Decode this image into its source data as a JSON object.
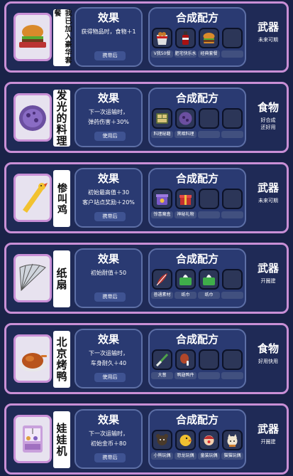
{
  "colors": {
    "card_border": "#c98fd6",
    "card_bg": "#1f2a56",
    "panel_bg": "#2a3a72",
    "panel_border": "#5d6fa6",
    "tag_bg": "#3f5392"
  },
  "items": [
    {
      "name": "我已加入豪华套餐",
      "icon": "burger-icon",
      "effect_title": "效果",
      "effect_desc": "获得物品时，食物＋1",
      "tag": "携带后",
      "recipe_title": "合成配方",
      "ingredients": [
        {
          "icon": "fried-chicken-bucket-icon",
          "label": "V我50餐"
        },
        {
          "icon": "cola-bottle-icon",
          "label": "肥宅快乐水"
        },
        {
          "icon": "burger-icon",
          "label": "经典套餐"
        },
        {
          "icon": "",
          "label": ""
        }
      ],
      "category": "武器",
      "category_note": "未来可期"
    },
    {
      "name": "发光的料理",
      "icon": "glowing-dish-icon",
      "effect_title": "效果",
      "effect_desc": "下一次运输时，\n弹药伤害＋30%",
      "tag": "使用后",
      "recipe_title": "合成配方",
      "ingredients": [
        {
          "icon": "recipe-book-icon",
          "label": "料理秘籍"
        },
        {
          "icon": "dark-dish-icon",
          "label": "黑暗料理"
        },
        {
          "icon": "",
          "label": ""
        },
        {
          "icon": "",
          "label": ""
        }
      ],
      "category": "食物",
      "category_note": "好合成\n还好用"
    },
    {
      "name": "惨叫鸡",
      "icon": "screaming-chicken-icon",
      "effect_title": "效果",
      "effect_desc": "初始最高值＋30\n客户站点奖励＋20%",
      "tag": "携带后",
      "recipe_title": "合成配方",
      "ingredients": [
        {
          "icon": "mystery-box-icon",
          "label": "惊喜魔盒"
        },
        {
          "icon": "gift-box-icon",
          "label": "神秘礼物"
        },
        {
          "icon": "",
          "label": ""
        },
        {
          "icon": "",
          "label": ""
        }
      ],
      "category": "武器",
      "category_note": "未来可期"
    },
    {
      "name": "纸扇",
      "icon": "paper-fan-icon",
      "effect_title": "效果",
      "effect_desc": "初始耐值＋50",
      "tag": "携带后",
      "recipe_title": "合成配方",
      "ingredients": [
        {
          "icon": "feather-icon",
          "label": "普通素材"
        },
        {
          "icon": "tissue-box-icon",
          "label": "纸巾"
        },
        {
          "icon": "tissue-box-icon",
          "label": "纸巾"
        },
        {
          "icon": "",
          "label": ""
        }
      ],
      "category": "武器",
      "category_note": "开圈建"
    },
    {
      "name": "北京烤鸭",
      "icon": "roast-duck-icon",
      "effect_title": "效果",
      "effect_desc": "下一次运输时，\n车身耐久＋40",
      "tag": "使用后",
      "recipe_title": "合成配方",
      "ingredients": [
        {
          "icon": "scallion-icon",
          "label": "大葱"
        },
        {
          "icon": "duck-leg-icon",
          "label": "鸭翅鸭件"
        },
        {
          "icon": "",
          "label": ""
        },
        {
          "icon": "",
          "label": ""
        }
      ],
      "category": "食物",
      "category_note": "好用快用"
    },
    {
      "name": "娃娃机",
      "icon": "claw-machine-icon",
      "effect_title": "效果",
      "effect_desc": "下一次运输时，\n初始金币＋80",
      "tag": "携带后",
      "recipe_title": "合成配方",
      "ingredients": [
        {
          "icon": "bear-doll-icon",
          "label": "小熊玩偶"
        },
        {
          "icon": "chick-doll-icon",
          "label": "恐龙玩偶"
        },
        {
          "icon": "clown-doll-icon",
          "label": "童装玩偶"
        },
        {
          "icon": "cat-doll-icon",
          "label": "猫猫玩偶"
        }
      ],
      "category": "武器",
      "category_note": "开圈建"
    }
  ]
}
